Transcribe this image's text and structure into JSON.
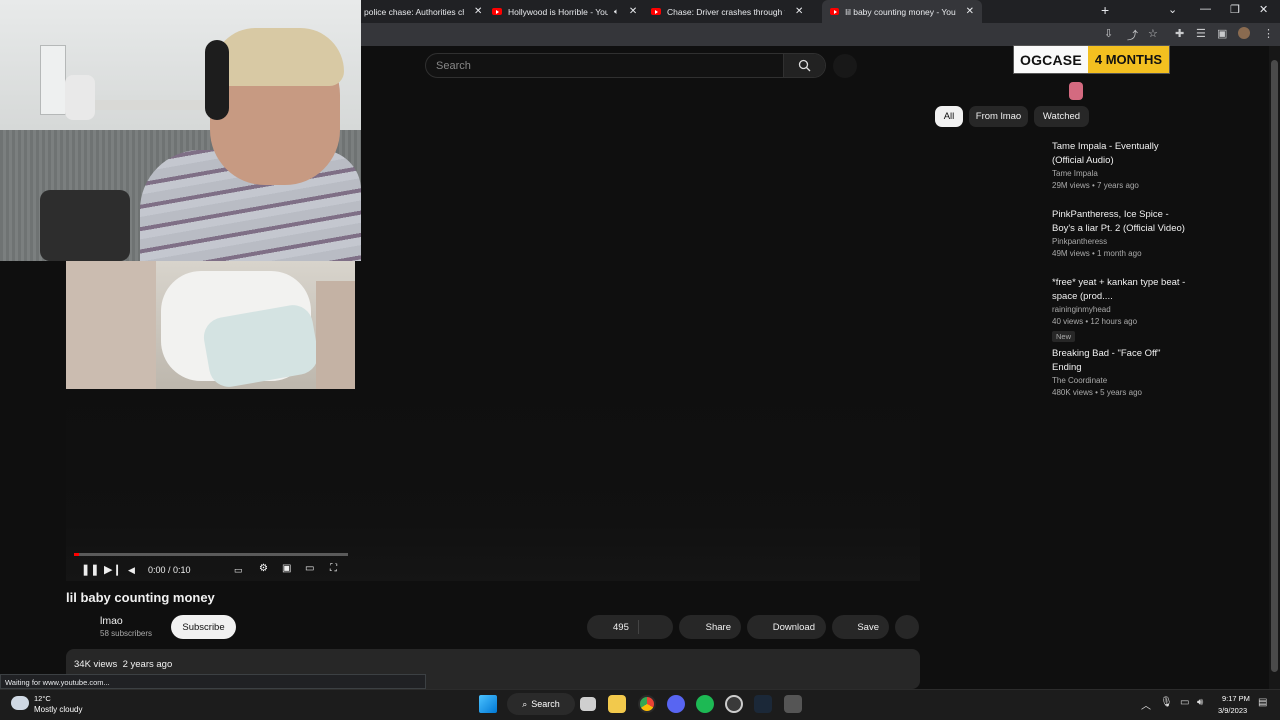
{
  "browser": {
    "tabs": [
      {
        "title": "police chase: Authorities ch",
        "active": false
      },
      {
        "title": "Hollywood is Horrible - YouT",
        "active": false
      },
      {
        "title": "Chase: Driver crashes through fe",
        "active": false
      },
      {
        "title": "lil baby counting money - YouTu",
        "active": true
      }
    ],
    "new_tab_glyph": "+",
    "status_text": "Waiting for www.youtube.com..."
  },
  "youtube": {
    "search_placeholder": "Search",
    "chips": [
      "All",
      "From lmao",
      "Watched"
    ],
    "video": {
      "title": "lil baby counting money",
      "current_time": "0:00 / 0:10",
      "progress_fraction": 0.02,
      "channel": "lmao",
      "subscribers": "58 subscribers",
      "subscribe_label": "Subscribe",
      "likes": "495",
      "share_label": "Share",
      "download_label": "Download",
      "save_label": "Save",
      "views": "34K views",
      "age": "2 years ago"
    },
    "recommendations": [
      {
        "title": "Tame Impala - Eventually (Official Audio)",
        "channel": "Tame Impala",
        "views": "29M views",
        "age": "7 years ago",
        "badge": ""
      },
      {
        "title": "PinkPantheress, Ice Spice - Boy's a liar Pt. 2 (Official Video)",
        "channel": "Pinkpantheress",
        "views": "49M views",
        "age": "1 month ago",
        "badge": ""
      },
      {
        "title": "*free* yeat + kankan type beat - space (prod....",
        "channel": "raininginmyhead",
        "views": "40 views",
        "age": "12 hours ago",
        "badge": "New"
      },
      {
        "title": "Breaking Bad - \"Face Off\" Ending",
        "channel": "The Coordinate",
        "views": "480K views",
        "age": "5 years ago",
        "badge": ""
      }
    ]
  },
  "overlay": {
    "sub_name": "OGCASE",
    "sub_months": "4 MONTHS"
  },
  "taskbar": {
    "weather_temp": "12°C",
    "weather_desc": "Mostly cloudy",
    "search_label": "Search",
    "time": "9:17 PM",
    "date": "3/9/2023"
  },
  "colors": {
    "accent": "#ff0000",
    "badge_yellow": "#f3c020",
    "background": "#0f0f0f"
  }
}
